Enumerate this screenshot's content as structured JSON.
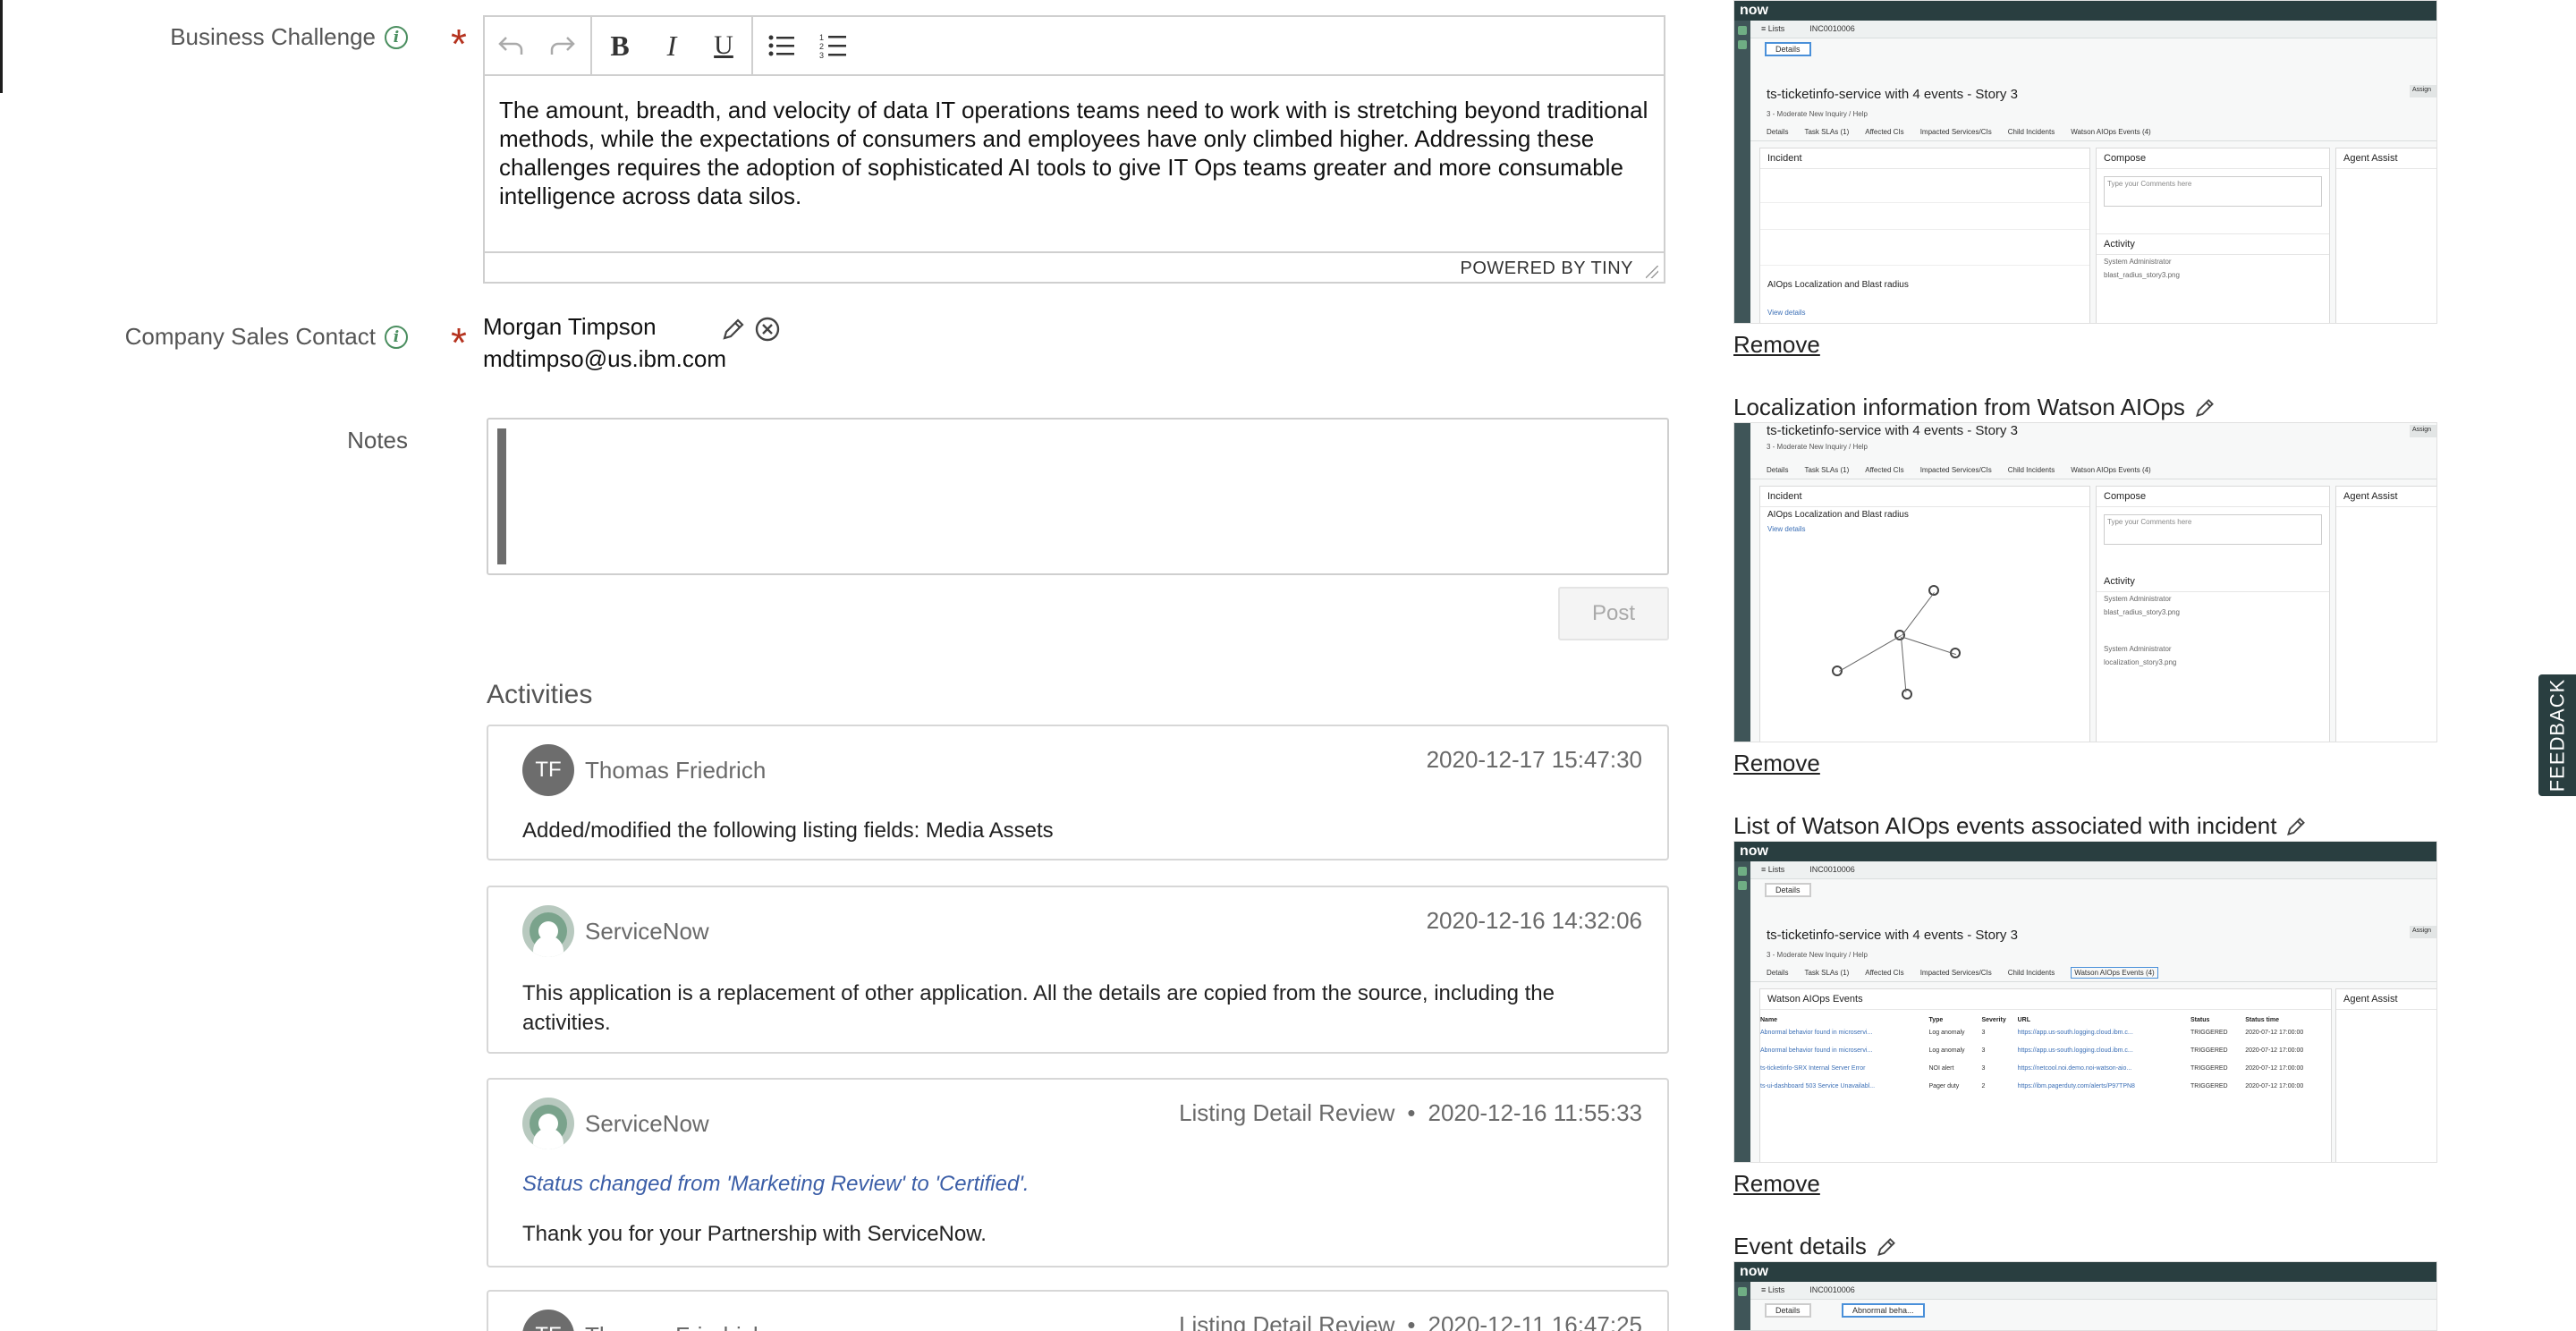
{
  "form": {
    "business_challenge_label": "Business Challenge",
    "business_challenge_text": "The amount, breadth, and velocity of data IT operations teams need to work with is stretching beyond traditional methods, while the expectations of consumers and employees have only climbed higher. Addressing these challenges requires the adoption of sophisticated AI tools to give IT Ops teams greater and more consumable intelligence across data silos.",
    "powered_by": "POWERED BY TINY",
    "sales_contact_label": "Company Sales Contact",
    "sales_contact_name": "Morgan Timpson",
    "sales_contact_email": "mdtimpso@us.ibm.com",
    "notes_label": "Notes",
    "post_label": "Post"
  },
  "activities": {
    "title": "Activities",
    "items": [
      {
        "initials": "TF",
        "author": "Thomas Friedrich",
        "type": "",
        "timestamp": "2020-12-17 15:47:30",
        "text": "Added/modified the following listing fields: Media Assets"
      },
      {
        "initials": "",
        "author": "ServiceNow",
        "type": "",
        "timestamp": "2020-12-16 14:32:06",
        "text": "This application is a replacement of other application. All the details are copied from the source, including the activities."
      },
      {
        "initials": "",
        "author": "ServiceNow",
        "type": "Listing Detail Review",
        "timestamp": "2020-12-16 11:55:33",
        "status": "Status changed from 'Marketing Review' to 'Certified'.",
        "text": "Thank you for your Partnership with ServiceNow."
      },
      {
        "initials": "TF",
        "author": "Thomas Friedrich",
        "type": "Listing Detail Review",
        "timestamp": "2020-12-11 16:47:25",
        "text": ""
      }
    ],
    "separator": "•"
  },
  "attachments": {
    "remove_label": "Remove",
    "items": [
      {
        "title": "Localization information from Watson AIOps"
      },
      {
        "title": "List of Watson AIOps events associated with incident"
      },
      {
        "title": "Event details"
      }
    ]
  },
  "screenshots": {
    "logo": "now",
    "lists_tab": "≡ Lists",
    "incident_tab": "INC0010006",
    "details_tab": "Details",
    "ticket_title": "ts-ticketinfo-service with 4 events - Story 3",
    "meta": "3 - Moderate    New    Inquiry / Help",
    "section_tabs": [
      "Details",
      "Task SLAs (1)",
      "Affected CIs",
      "Impacted Services/CIs",
      "Child Incidents",
      "Watson AIOps Events (4)"
    ],
    "incident_header": "Incident",
    "compose_header": "Compose",
    "agent_assist_header": "Agent Assist",
    "activity_header": "Activity",
    "blast_header": "AIOps Localization and Blast radius",
    "view_details": "View details",
    "comment_placeholder": "Type your Comments here",
    "system_admin": "System Administrator",
    "file1": "blast_radius_story3.png",
    "file2": "localization_story3.png",
    "events_header": "Watson AIOps Events",
    "events_columns": [
      "Name",
      "Type",
      "Severity",
      "URL",
      "Status",
      "Status time"
    ],
    "events_rows": [
      [
        "Abnormal behavior found in microservi...",
        "Log anomaly",
        "3",
        "https://app.us-south.logging.cloud.ibm.c...",
        "TRIGGERED",
        "2020-07-12 17:00:00"
      ],
      [
        "Abnormal behavior found in microservi...",
        "Log anomaly",
        "3",
        "https://app.us-south.logging.cloud.ibm.c...",
        "TRIGGERED",
        "2020-07-12 17:00:00"
      ],
      [
        "ts-ticketinfo-SRX Internal Server Error",
        "NOI alert",
        "3",
        "https://netcool.noi.demo.noi-watson-aio...",
        "TRIGGERED",
        "2020-07-12 17:00:00"
      ],
      [
        "ts-ui-dashboard 503 Service Unavailabl...",
        "Pager duty",
        "2",
        "https://ibm.pagerduty.com/alerts/P97TPN8",
        "TRIGGERED",
        "2020-07-12 17:00:00"
      ]
    ],
    "assign_label": "Assign",
    "event_tab": "Abnormal beha..."
  },
  "feedback_label": "FEEDBACK",
  "colors": {
    "required": "#b5331f",
    "info": "#4a8e5f",
    "status_link": "#3b5ea7",
    "brand_dark": "#293e40"
  }
}
